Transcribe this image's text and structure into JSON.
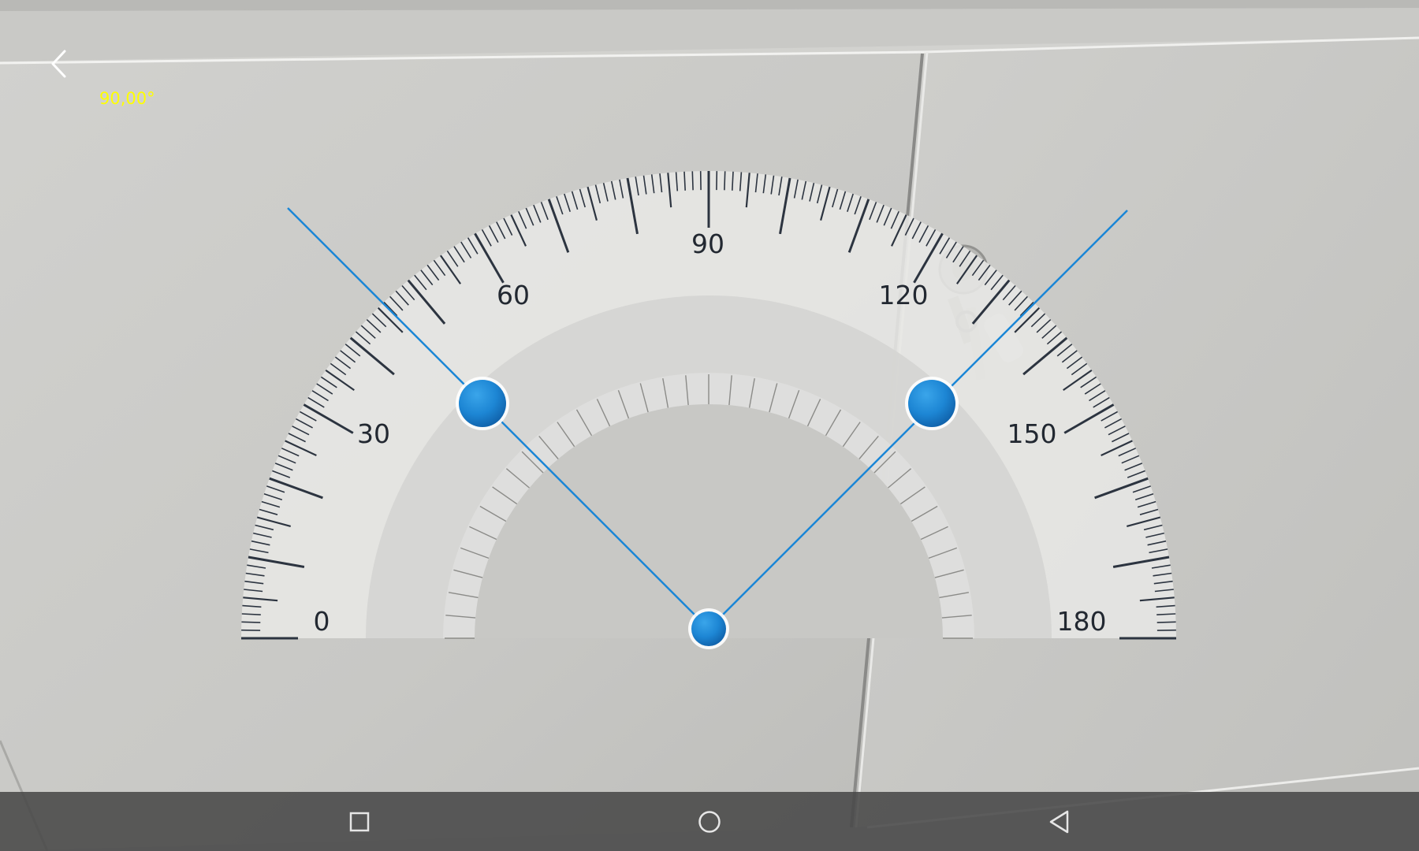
{
  "app": {
    "angle_readout": "90,00°",
    "readout_color": "#ffff00",
    "accent_color": "#1a86d6"
  },
  "toolbar": {
    "back_icon": "chevron-left-icon"
  },
  "protractor": {
    "scale_labels": [
      "0",
      "30",
      "60",
      "90",
      "120",
      "150",
      "180"
    ],
    "arm_angles_deg": [
      45,
      135
    ],
    "measured_angle_deg": 90
  },
  "nav_bar": {
    "recents_icon": "square-icon",
    "home_icon": "circle-icon",
    "back_icon": "triangle-back-icon"
  }
}
